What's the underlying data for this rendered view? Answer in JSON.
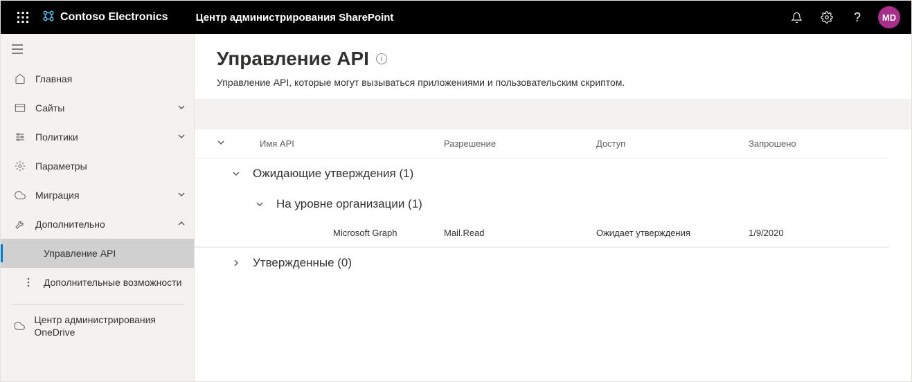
{
  "header": {
    "brand_name": "Contoso Electronics",
    "app_title": "Центр администрирования SharePoint",
    "avatar_initials": "MD"
  },
  "sidebar": {
    "items": [
      {
        "label": "Главная",
        "icon": "home"
      },
      {
        "label": "Сайты",
        "icon": "site",
        "expandable": true
      },
      {
        "label": "Политики",
        "icon": "policy",
        "expandable": true
      },
      {
        "label": "Параметры",
        "icon": "settings"
      },
      {
        "label": "Миграция",
        "icon": "migration",
        "expandable": true
      },
      {
        "label": "Дополнительно",
        "icon": "more",
        "expandable": true,
        "expanded": true
      }
    ],
    "sub_items": [
      {
        "label": "Управление API"
      },
      {
        "label": "Дополнительные возможности"
      }
    ],
    "footer_item": {
      "label": "Центр администрирования OneDrive"
    }
  },
  "page": {
    "title": "Управление API",
    "subtitle": "Управление API, которые могут вызываться приложениями и пользовательским скриптом."
  },
  "table": {
    "columns": {
      "name": "Имя API",
      "permission": "Разрешение",
      "access": "Доступ",
      "requested": "Запрошено"
    },
    "groups": {
      "pending": "Ожидающие утверждения (1)",
      "org": "На уровне организации (1)",
      "approved": "Утвержденные (0)"
    },
    "rows": [
      {
        "name": "Microsoft Graph",
        "permission": "Mail.Read",
        "access": "Ожидает утверждения",
        "requested": "1/9/2020"
      }
    ]
  }
}
